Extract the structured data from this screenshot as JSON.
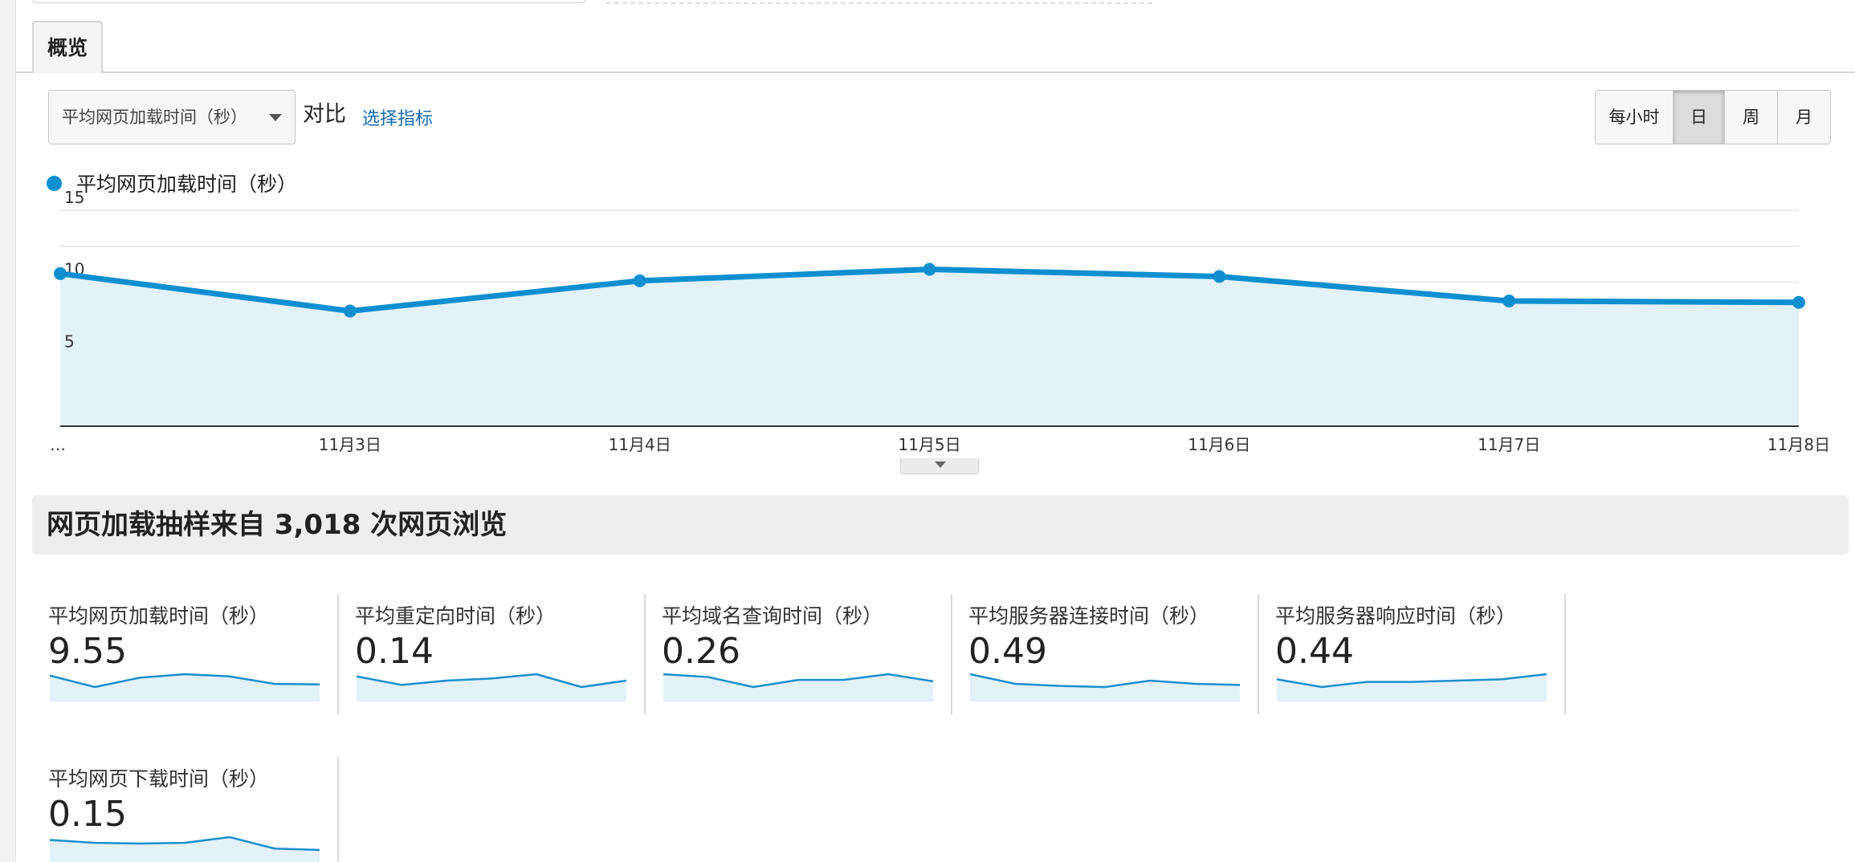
{
  "tab": {
    "label": "概览"
  },
  "toolbar": {
    "metric_select": "平均网页加载时间（秒）",
    "compare_label": "对比",
    "choose_metric": "选择指标",
    "periods": [
      "每小时",
      "日",
      "周",
      "月"
    ],
    "active_period": "日"
  },
  "legend": {
    "label": "平均网页加载时间（秒）",
    "color": "#0f8fd0"
  },
  "chart_data": {
    "type": "area",
    "x": [
      "…",
      "11月3日",
      "11月4日",
      "11月5日",
      "11月6日",
      "11月7日",
      "11月8日"
    ],
    "series": [
      {
        "name": "平均网页加载时间（秒）",
        "values": [
          10.6,
          8.0,
          10.1,
          10.9,
          10.4,
          8.7,
          8.6
        ]
      }
    ],
    "y_ticks": [
      "15",
      "10",
      "5"
    ],
    "ylim": [
      0,
      15
    ],
    "grid": true,
    "color": "#0f8fd0",
    "fill": "#e3f1f8"
  },
  "summary": {
    "title": "网页加载抽样来自 3,018 次网页浏览"
  },
  "metrics": [
    {
      "label": "平均网页加载时间（秒）",
      "value": "9.55",
      "spark": [
        10.6,
        8.0,
        10.1,
        10.9,
        10.4,
        8.7,
        8.6
      ]
    },
    {
      "label": "平均重定向时间（秒）",
      "value": "0.14",
      "spark": [
        0.15,
        0.11,
        0.13,
        0.14,
        0.16,
        0.1,
        0.13
      ]
    },
    {
      "label": "平均域名查询时间（秒）",
      "value": "0.26",
      "spark": [
        0.29,
        0.27,
        0.2,
        0.25,
        0.25,
        0.29,
        0.24
      ]
    },
    {
      "label": "平均服务器连接时间（秒）",
      "value": "0.49",
      "spark": [
        0.58,
        0.49,
        0.47,
        0.46,
        0.52,
        0.49,
        0.48
      ]
    },
    {
      "label": "平均服务器响应时间（秒）",
      "value": "0.44",
      "spark": [
        0.44,
        0.38,
        0.42,
        0.42,
        0.43,
        0.44,
        0.48
      ]
    },
    {
      "label": "平均网页下载时间（秒）",
      "value": "0.15",
      "spark": [
        0.16,
        0.14,
        0.135,
        0.14,
        0.18,
        0.1,
        0.09
      ]
    }
  ]
}
